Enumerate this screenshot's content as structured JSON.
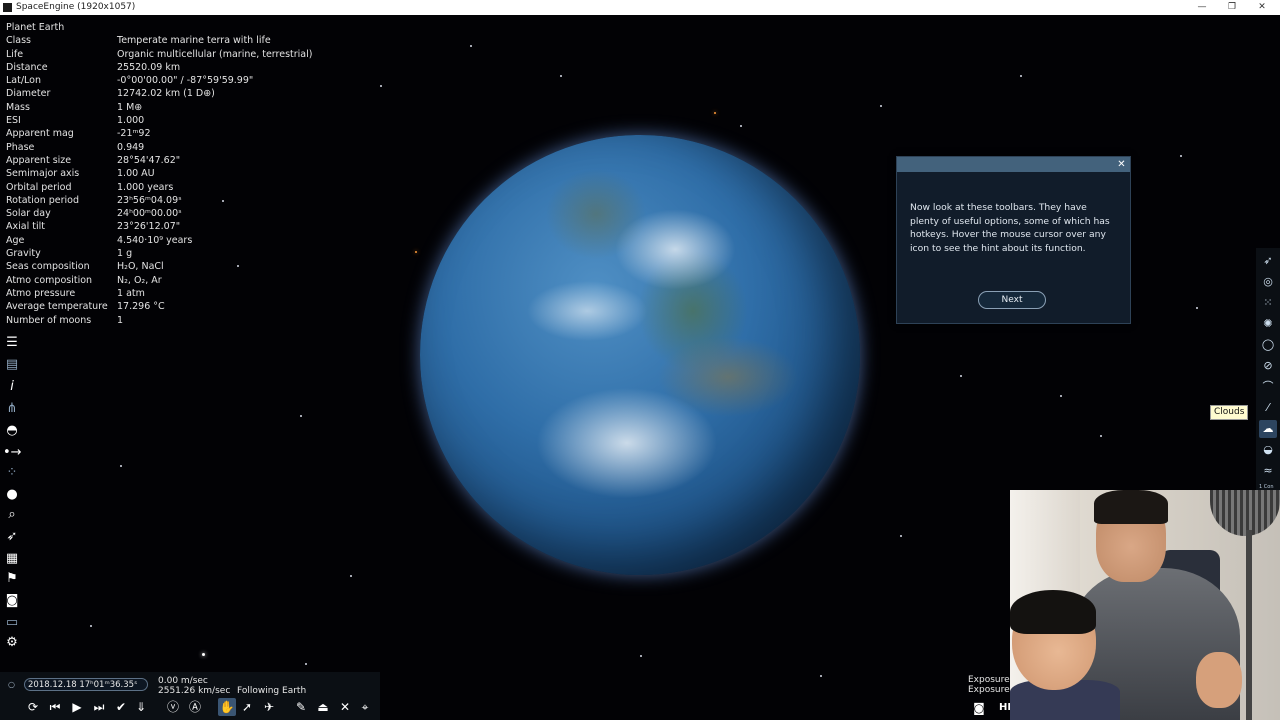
{
  "window": {
    "title": "SpaceEngine (1920x1057)",
    "controls": [
      "—",
      "❐",
      "✕"
    ]
  },
  "info_panel": {
    "rows": [
      {
        "label": "Planet  Earth",
        "value": ""
      },
      {
        "label": "Class",
        "value": "Temperate marine terra with life"
      },
      {
        "label": "Life",
        "value": "Organic multicellular (marine, terrestrial)"
      },
      {
        "label": "Distance",
        "value": "25520.09 km"
      },
      {
        "label": "Lat/Lon",
        "value": "-0°00'00.00\" / -87°59'59.99\""
      },
      {
        "label": "Diameter",
        "value": "12742.02 km (1 D⊕)"
      },
      {
        "label": "Mass",
        "value": "1 M⊕"
      },
      {
        "label": "ESI",
        "value": "1.000"
      },
      {
        "label": "Apparent mag",
        "value": "-21ᵐ92"
      },
      {
        "label": "Phase",
        "value": "0.949"
      },
      {
        "label": "Apparent size",
        "value": "28°54'47.62\""
      },
      {
        "label": "Semimajor axis",
        "value": "1.00 AU"
      },
      {
        "label": "Orbital period",
        "value": "1.000 years"
      },
      {
        "label": "Rotation period",
        "value": "23ʰ56ᵐ04.09ˢ"
      },
      {
        "label": "Solar day",
        "value": "24ʰ00ᵐ00.00ˢ"
      },
      {
        "label": "Axial tilt",
        "value": "23°26'12.07\""
      },
      {
        "label": "Age",
        "value": "4.540·10⁹ years"
      },
      {
        "label": "Gravity",
        "value": "1 g"
      },
      {
        "label": "Seas composition",
        "value": "H₂O, NaCl"
      },
      {
        "label": "Atmo composition",
        "value": "N₂, O₂, Ar"
      },
      {
        "label": "Atmo pressure",
        "value": "1 atm"
      },
      {
        "label": "Average temperature",
        "value": "17.296 °C"
      },
      {
        "label": "Number of moons",
        "value": "1"
      }
    ]
  },
  "dialog": {
    "close": "✕",
    "message": "Now look at these toolbars. They have plenty of useful options, some of which has hotkeys. Hover the mouse cursor over any icon to see the hint about its function.",
    "next_label": "Next"
  },
  "tooltip": "Clouds",
  "right_toolbar": {
    "footer": "1 Con",
    "icons": [
      "ship-icon",
      "galaxy-icon",
      "nebula-icon",
      "star-icon",
      "planet-icon",
      "ring-icon",
      "orbit-icon",
      "comet-icon",
      "clouds-icon",
      "atmosphere-icon",
      "water-icon"
    ]
  },
  "left_toolbar": {
    "icons": [
      "menu-icon",
      "list-icon",
      "info-icon",
      "settings-grid-icon",
      "binoculars-icon",
      "route-icon",
      "constellation-icon",
      "planet-select-icon",
      "search-icon",
      "ship-icon",
      "document-icon",
      "flag-icon",
      "camera-icon",
      "monitor-icon",
      "gear-icon"
    ]
  },
  "bottom_bar": {
    "datetime": "2018.12.18 17ʰ01ᵐ36.35ˢ",
    "speed": "0.00 m/sec",
    "velocity": "2551.26 km/sec",
    "status": "Following Earth"
  },
  "exposure": {
    "line1": "Exposure",
    "line2": "Exposure",
    "hd": "HD"
  }
}
